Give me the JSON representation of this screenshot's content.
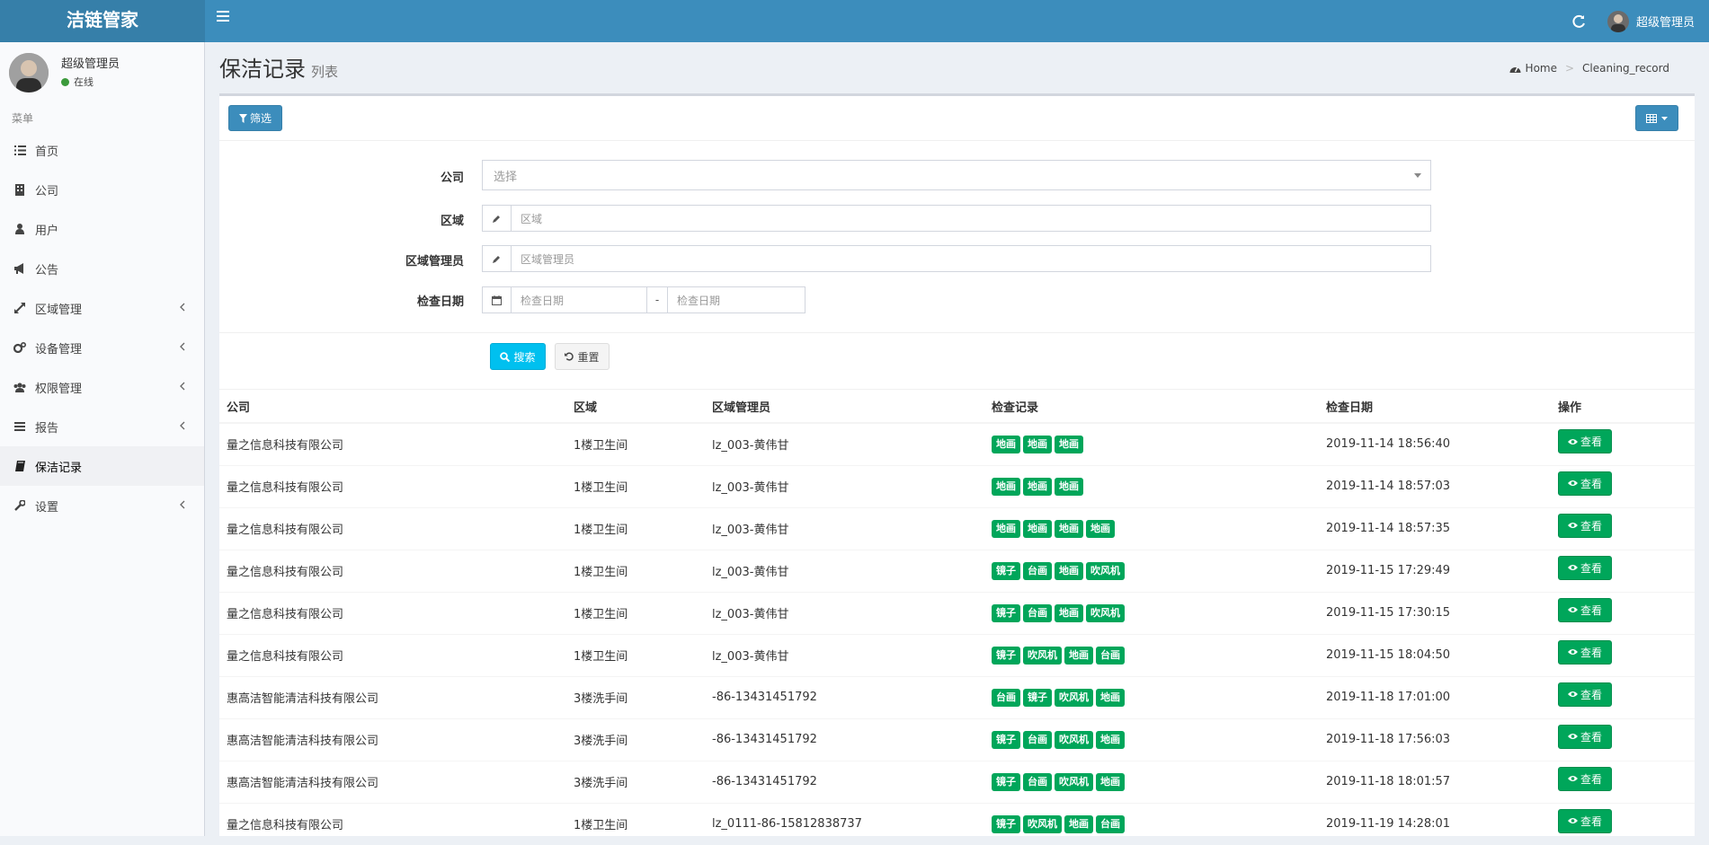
{
  "app": {
    "logo": "洁链管家",
    "user": "超级管理员"
  },
  "sidebar": {
    "user_name": "超级管理员",
    "status": "在线",
    "menu_header": "菜单",
    "items": [
      {
        "label": "首页",
        "icon": "list-icon"
      },
      {
        "label": "公司",
        "icon": "building-icon"
      },
      {
        "label": "用户",
        "icon": "user-icon"
      },
      {
        "label": "公告",
        "icon": "bullhorn-icon"
      },
      {
        "label": "区域管理",
        "icon": "expand-icon"
      },
      {
        "label": "设备管理",
        "icon": "gears-icon"
      },
      {
        "label": "权限管理",
        "icon": "users-icon"
      },
      {
        "label": "报告",
        "icon": "bars-icon"
      },
      {
        "label": "保洁记录",
        "icon": "book-icon"
      },
      {
        "label": "设置",
        "icon": "wrench-icon"
      }
    ]
  },
  "header": {
    "title": "保洁记录",
    "subtitle": "列表",
    "breadcrumb": [
      "Home",
      "Cleaning_record"
    ]
  },
  "toolbar": {
    "filter_label": "筛选"
  },
  "filters": {
    "company_label": "公司",
    "company_placeholder": "选择",
    "area_label": "区域",
    "area_placeholder": "区域",
    "manager_label": "区域管理员",
    "manager_placeholder": "区域管理员",
    "date_label": "检查日期",
    "date_start_placeholder": "检查日期",
    "date_sep": "-",
    "date_end_placeholder": "检查日期",
    "search_label": "搜索",
    "reset_label": "重置"
  },
  "table": {
    "columns": [
      "公司",
      "区域",
      "区域管理员",
      "检查记录",
      "检查日期",
      "操作"
    ],
    "view_label": "查看",
    "rows": [
      {
        "company": "量之信息科技有限公司",
        "area": "1楼卫生间",
        "manager": "lz_003-黄伟甘",
        "tags": [
          "地画",
          "地画",
          "地画"
        ],
        "date": "2019-11-14 18:56:40"
      },
      {
        "company": "量之信息科技有限公司",
        "area": "1楼卫生间",
        "manager": "lz_003-黄伟甘",
        "tags": [
          "地画",
          "地画",
          "地画"
        ],
        "date": "2019-11-14 18:57:03"
      },
      {
        "company": "量之信息科技有限公司",
        "area": "1楼卫生间",
        "manager": "lz_003-黄伟甘",
        "tags": [
          "地画",
          "地画",
          "地画",
          "地画"
        ],
        "date": "2019-11-14 18:57:35"
      },
      {
        "company": "量之信息科技有限公司",
        "area": "1楼卫生间",
        "manager": "lz_003-黄伟甘",
        "tags": [
          "镜子",
          "台画",
          "地画",
          "吹风机"
        ],
        "date": "2019-11-15 17:29:49"
      },
      {
        "company": "量之信息科技有限公司",
        "area": "1楼卫生间",
        "manager": "lz_003-黄伟甘",
        "tags": [
          "镜子",
          "台画",
          "地画",
          "吹风机"
        ],
        "date": "2019-11-15 17:30:15"
      },
      {
        "company": "量之信息科技有限公司",
        "area": "1楼卫生间",
        "manager": "lz_003-黄伟甘",
        "tags": [
          "镜子",
          "吹风机",
          "地画",
          "台画"
        ],
        "date": "2019-11-15 18:04:50"
      },
      {
        "company": "惠高洁智能清洁科技有限公司",
        "area": "3楼洗手间",
        "manager": "-86-13431451792",
        "tags": [
          "台画",
          "镜子",
          "吹风机",
          "地画"
        ],
        "date": "2019-11-18 17:01:00"
      },
      {
        "company": "惠高洁智能清洁科技有限公司",
        "area": "3楼洗手间",
        "manager": "-86-13431451792",
        "tags": [
          "镜子",
          "台画",
          "吹风机",
          "地画"
        ],
        "date": "2019-11-18 17:56:03"
      },
      {
        "company": "惠高洁智能清洁科技有限公司",
        "area": "3楼洗手间",
        "manager": "-86-13431451792",
        "tags": [
          "镜子",
          "台画",
          "吹风机",
          "地画"
        ],
        "date": "2019-11-18 18:01:57"
      },
      {
        "company": "量之信息科技有限公司",
        "area": "1楼卫生间",
        "manager": "lz_0111-86-15812838737",
        "tags": [
          "镜子",
          "吹风机",
          "地画",
          "台画"
        ],
        "date": "2019-11-19 14:28:01"
      }
    ]
  }
}
